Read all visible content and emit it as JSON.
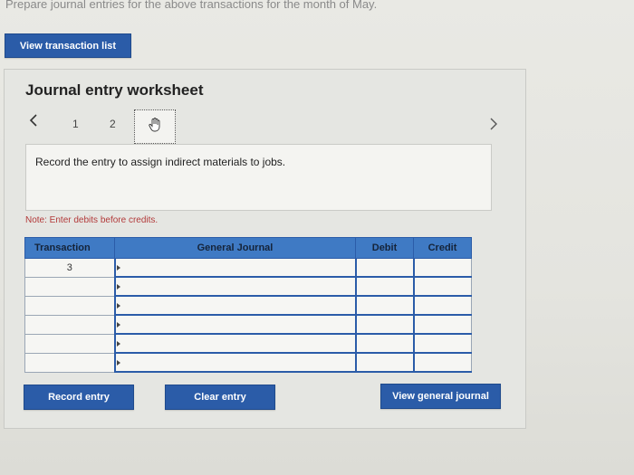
{
  "header": {
    "instruction_top": "Prepare journal entries for the above transactions for the month of May."
  },
  "toolbar": {
    "view_transaction_list": "View transaction list"
  },
  "worksheet": {
    "title": "Journal entry worksheet",
    "pages": [
      "1",
      "2"
    ],
    "instruction": "Record the entry to assign indirect materials to jobs.",
    "note": "Note: Enter debits before credits."
  },
  "table": {
    "headers": [
      "Transaction",
      "General Journal",
      "Debit",
      "Credit"
    ],
    "rows": [
      {
        "transaction": "3"
      },
      {
        "transaction": ""
      },
      {
        "transaction": ""
      },
      {
        "transaction": ""
      },
      {
        "transaction": ""
      },
      {
        "transaction": ""
      }
    ]
  },
  "actions": {
    "record_entry": "Record entry",
    "clear_entry": "Clear entry",
    "view_general_journal": "View general journal"
  },
  "colors": {
    "accent": "#2b5ca8",
    "header": "#3f7ac4",
    "note": "#b23a3a"
  },
  "icons": [
    "chevron-left-icon",
    "chevron-right-icon",
    "hand-cursor-icon",
    "dropdown-triangle-icon"
  ]
}
